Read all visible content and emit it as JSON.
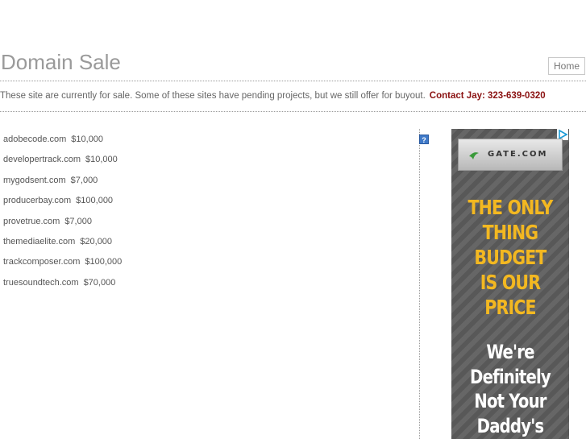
{
  "header": {
    "title": "Domain Sale",
    "home_label": "Home"
  },
  "intro": {
    "text": "These site are currently for sale. Some of these sites have pending projects, but we still offer for buyout.",
    "contact": "Contact Jay: 323-639-0320"
  },
  "domains": [
    {
      "name": "adobecode.com",
      "price": "$10,000"
    },
    {
      "name": "developertrack.com",
      "price": "$10,000"
    },
    {
      "name": "mygodsent.com",
      "price": "$7,000"
    },
    {
      "name": "producerbay.com",
      "price": "$100,000"
    },
    {
      "name": "provetrue.com",
      "price": "$7,000"
    },
    {
      "name": "themediaelite.com",
      "price": "$20,000"
    },
    {
      "name": "trackcomposer.com",
      "price": "$100,000"
    },
    {
      "name": "truesoundtech.com",
      "price": "$70,000"
    }
  ],
  "ad": {
    "logo_text": "GATE.COM",
    "headline": [
      "THE ONLY",
      "THING",
      "BUDGET",
      "IS OUR",
      "PRICE"
    ],
    "subline": [
      "We're",
      "Definitely",
      "Not Your",
      "Daddy's"
    ],
    "colors": {
      "headline": "#f3b821",
      "background": "#5d5d5d",
      "subline": "#ffffff"
    },
    "icons": {
      "help": "help-question-icon",
      "ad_choices": "adchoices-triangle-icon",
      "logo": "gate-logo-icon"
    }
  },
  "colors": {
    "title": "#9a9a9a",
    "contact": "#8a1111",
    "text": "#555555"
  }
}
